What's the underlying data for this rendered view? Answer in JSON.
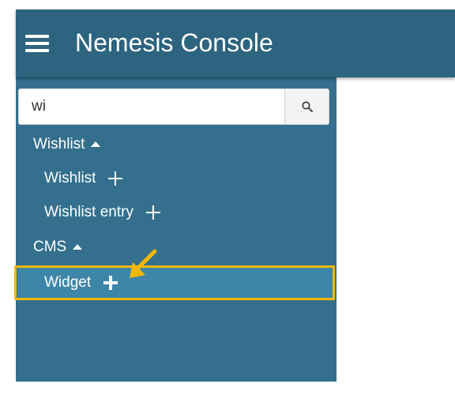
{
  "header": {
    "title": "Nemesis Console",
    "menu_icon": "hamburger-menu-icon"
  },
  "search": {
    "value": "wi",
    "icon": "search-icon"
  },
  "tree": {
    "groups": [
      {
        "label": "Wishlist",
        "expanded": true,
        "items": [
          "Wishlist",
          "Wishlist entry"
        ]
      },
      {
        "label": "CMS",
        "expanded": true,
        "items": [
          "Widget"
        ]
      }
    ]
  },
  "colors": {
    "header_bg": "#2d6480",
    "sidebar_bg": "#34708e",
    "selected_row_bg": "#3e86a8",
    "highlight": "#f5b800"
  }
}
